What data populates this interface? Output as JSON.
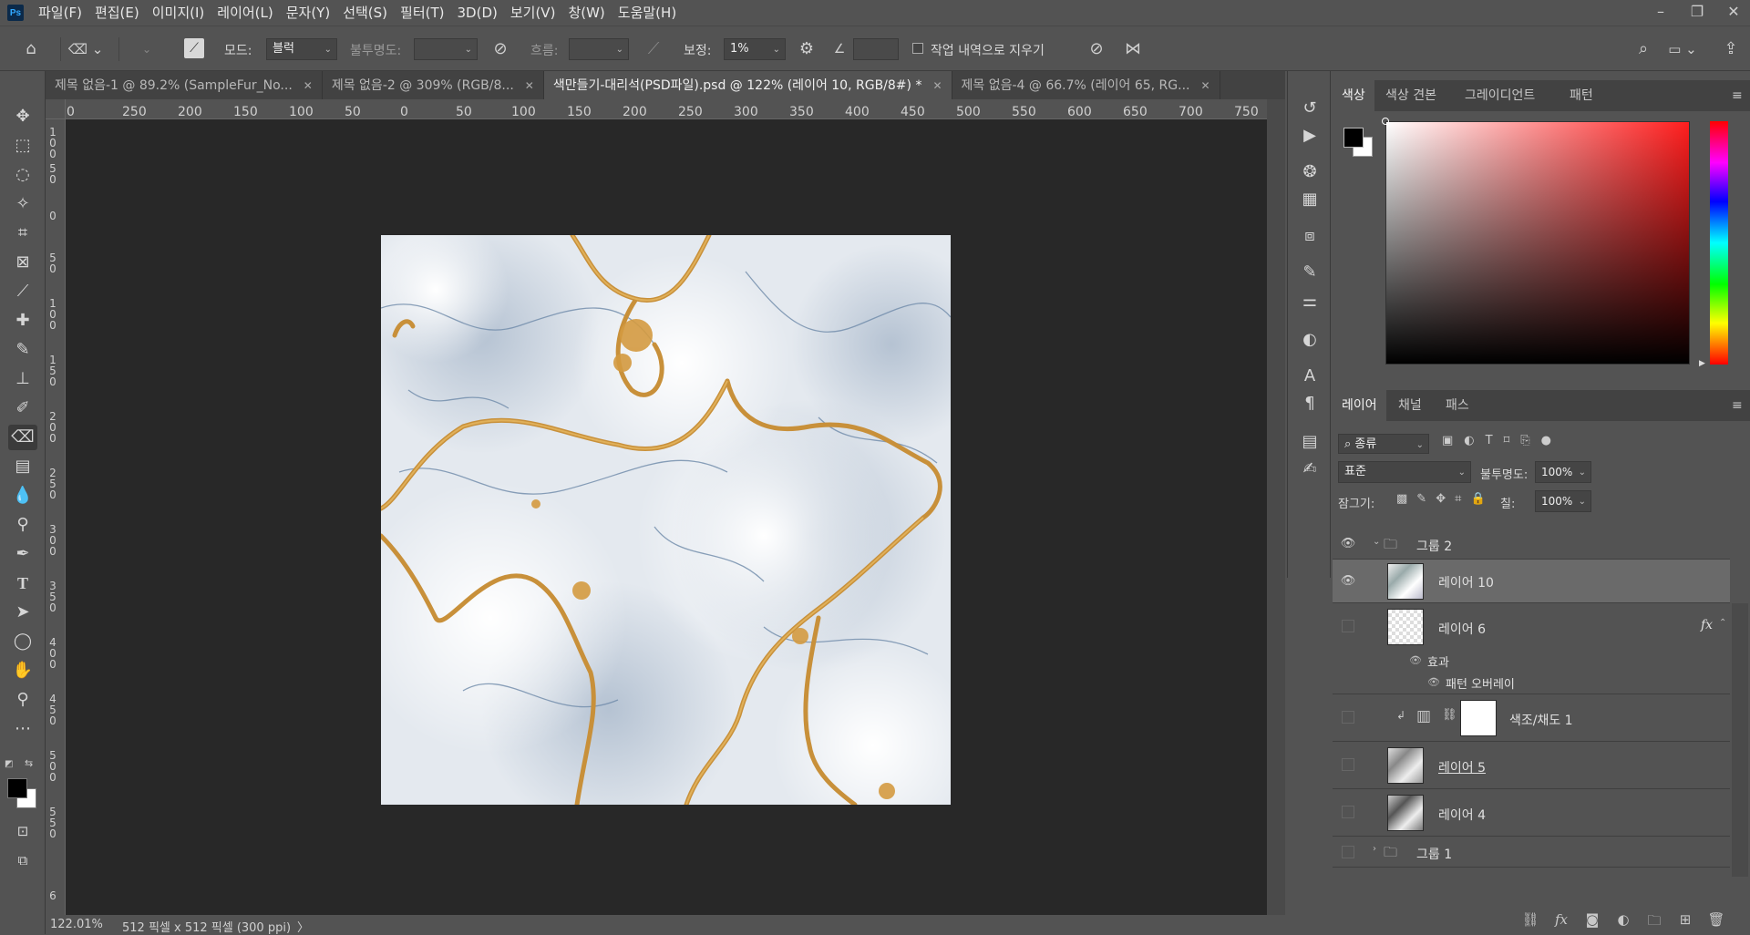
{
  "app": {
    "logo": "Ps"
  },
  "menu": [
    "파일(F)",
    "편집(E)",
    "이미지(I)",
    "레이어(L)",
    "문자(Y)",
    "선택(S)",
    "필터(T)",
    "3D(D)",
    "보기(V)",
    "창(W)",
    "도움말(H)"
  ],
  "window_controls": {
    "minimize": "–",
    "restore": "❐",
    "close": "✕"
  },
  "options": {
    "mode_label": "모드:",
    "mode_value": "블럭",
    "opacity_label": "불투명도:",
    "flow_label": "흐름:",
    "smoothing_label": "보정:",
    "smoothing_value": "1%",
    "erase_history_label": "작업 내역으로 지우기"
  },
  "tabs": [
    {
      "label": "제목 없음-1 @ 89.2% (SampleFur_No...",
      "close": "✕"
    },
    {
      "label": "제목 없음-2 @ 309% (RGB/8...",
      "close": "✕"
    },
    {
      "label": "색만들기-대리석(PSD파일).psd @ 122% (레이어 10, RGB/8#) *",
      "close": "✕"
    },
    {
      "label": "제목 없음-4 @ 66.7% (레이어 65, RG...",
      "close": "✕"
    }
  ],
  "ruler_h": [
    "0",
    "250",
    "200",
    "150",
    "100",
    "50",
    "0",
    "50",
    "100",
    "150",
    "200",
    "250",
    "300",
    "350",
    "400",
    "450",
    "500",
    "550",
    "600",
    "650",
    "700",
    "750"
  ],
  "ruler_v": [
    "1\n0\n0",
    "5\n0",
    "0",
    "5\n0",
    "1\n0\n0",
    "1\n5\n0",
    "2\n0\n0",
    "2\n5\n0",
    "3\n0\n0",
    "3\n5\n0",
    "4\n0\n0",
    "4\n5\n0",
    "5\n0\n0",
    "5\n5\n0",
    "6"
  ],
  "status": {
    "zoom": "122.01%",
    "doc_size": "512 픽셀 x 512 픽셀 (300 ppi)",
    "arrow": "〉"
  },
  "color_panel": {
    "tabs": [
      "색상",
      "색상 견본",
      "그레이디언트",
      "패턴"
    ],
    "foreground": "#000000",
    "background": "#ffffff"
  },
  "layers_panel": {
    "tabs": [
      "레이어",
      "채널",
      "패스"
    ],
    "filter_label": "종류",
    "blend_mode": "표준",
    "opacity_label": "불투명도:",
    "opacity_value": "100%",
    "lock_label": "잠그기:",
    "fill_label": "칠:",
    "fill_value": "100%",
    "layers": [
      {
        "name": "그룹 2",
        "type": "group",
        "visible": true
      },
      {
        "name": "레이어 10",
        "type": "layer",
        "visible": true,
        "selected": true
      },
      {
        "name": "레이어 6",
        "type": "layer",
        "visible": false,
        "fx": "fx"
      },
      {
        "name": "효과",
        "type": "effect"
      },
      {
        "name": "패턴 오버레이",
        "type": "effect-item"
      },
      {
        "name": "색조/채도 1",
        "type": "adjustment",
        "visible": false
      },
      {
        "name": "레이어 5",
        "type": "layer",
        "visible": false
      },
      {
        "name": "레이어 4",
        "type": "layer",
        "visible": false
      },
      {
        "name": "그룹 1",
        "type": "group",
        "visible": false
      }
    ]
  }
}
